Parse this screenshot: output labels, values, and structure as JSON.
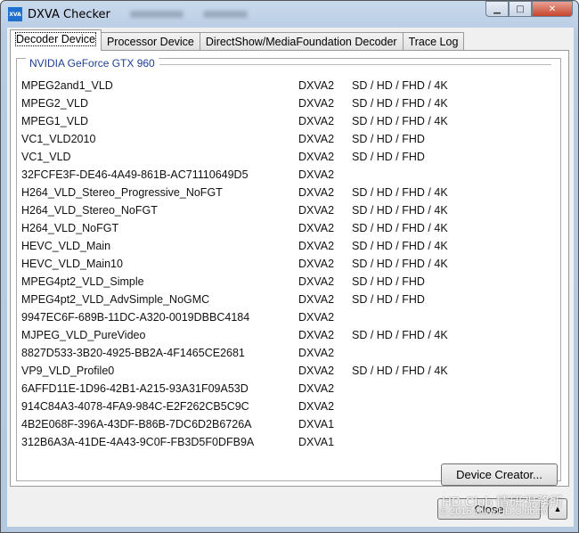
{
  "window": {
    "title": "DXVA Checker",
    "icon_text": "XVA"
  },
  "tabs": [
    "Decoder Device",
    "Processor Device",
    "DirectShow/MediaFoundation Decoder",
    "Trace Log"
  ],
  "group_label": "NVIDIA GeForce GTX 960",
  "rows": [
    [
      "MPEG2and1_VLD",
      "DXVA2",
      "SD / HD / FHD / 4K"
    ],
    [
      "MPEG2_VLD",
      "DXVA2",
      "SD / HD / FHD / 4K"
    ],
    [
      "MPEG1_VLD",
      "DXVA2",
      "SD / HD / FHD / 4K"
    ],
    [
      "VC1_VLD2010",
      "DXVA2",
      "SD / HD / FHD"
    ],
    [
      "VC1_VLD",
      "DXVA2",
      "SD / HD / FHD"
    ],
    [
      "32FCFE3F-DE46-4A49-861B-AC71110649D5",
      "DXVA2",
      ""
    ],
    [
      "H264_VLD_Stereo_Progressive_NoFGT",
      "DXVA2",
      "SD / HD / FHD / 4K"
    ],
    [
      "H264_VLD_Stereo_NoFGT",
      "DXVA2",
      "SD / HD / FHD / 4K"
    ],
    [
      "H264_VLD_NoFGT",
      "DXVA2",
      "SD / HD / FHD / 4K"
    ],
    [
      "HEVC_VLD_Main",
      "DXVA2",
      "SD / HD / FHD / 4K"
    ],
    [
      "HEVC_VLD_Main10",
      "DXVA2",
      "SD / HD / FHD / 4K"
    ],
    [
      "MPEG4pt2_VLD_Simple",
      "DXVA2",
      "SD / HD / FHD"
    ],
    [
      "MPEG4pt2_VLD_AdvSimple_NoGMC",
      "DXVA2",
      "SD / HD / FHD"
    ],
    [
      "9947EC6F-689B-11DC-A320-0019DBBC4184",
      "DXVA2",
      ""
    ],
    [
      "MJPEG_VLD_PureVideo",
      "DXVA2",
      "SD / HD / FHD / 4K"
    ],
    [
      "8827D533-3B20-4925-BB2A-4F1465CE2681",
      "DXVA2",
      ""
    ],
    [
      "VP9_VLD_Profile0",
      "DXVA2",
      "SD / HD / FHD / 4K"
    ],
    [
      "6AFFD11E-1D96-42B1-A215-93A31F09A53D",
      "DXVA2",
      ""
    ],
    [
      "914C84A3-4078-4FA9-984C-E2F262CB5C9C",
      "DXVA2",
      ""
    ],
    [
      "4B2E068F-396A-43DF-B86B-7DC6D2B6726A",
      "DXVA1",
      ""
    ],
    [
      "312B6A3A-41DE-4A43-9C0F-FB3D5F0DFB9A",
      "DXVA1",
      ""
    ]
  ],
  "buttons": {
    "device_creator": "Device Creator...",
    "close": "Close",
    "up": "▲"
  },
  "watermark": {
    "line1": "HD.Club 情研視務所",
    "line2": "© 2015 www.HD.Club.tw"
  }
}
